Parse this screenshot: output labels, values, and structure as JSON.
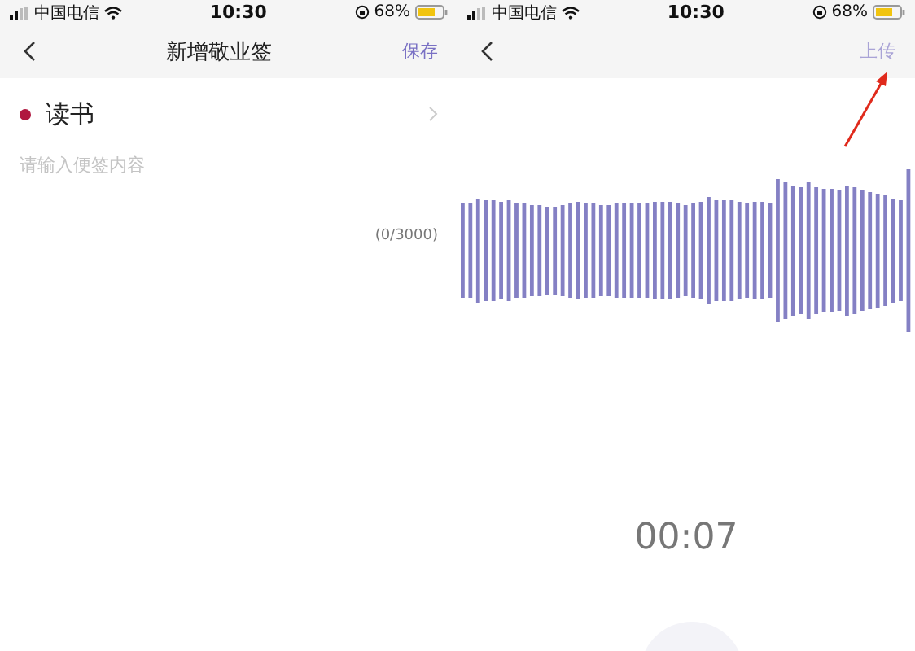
{
  "screens": [
    {
      "status_bar": {
        "carrier": "中国电信",
        "time": "10:30",
        "battery": "68%"
      },
      "nav": {
        "title": "新增敬业签",
        "action": "保存"
      },
      "category": {
        "label": "读书",
        "color": "#b0173f"
      },
      "note_field": {
        "placeholder": "请输入便签内容"
      },
      "counter": "(0/3000)"
    },
    {
      "status_bar": {
        "carrier": "中国电信",
        "time": "10:30",
        "battery": "68%"
      },
      "nav": {
        "action": "上传"
      },
      "timer": "00:07"
    }
  ]
}
